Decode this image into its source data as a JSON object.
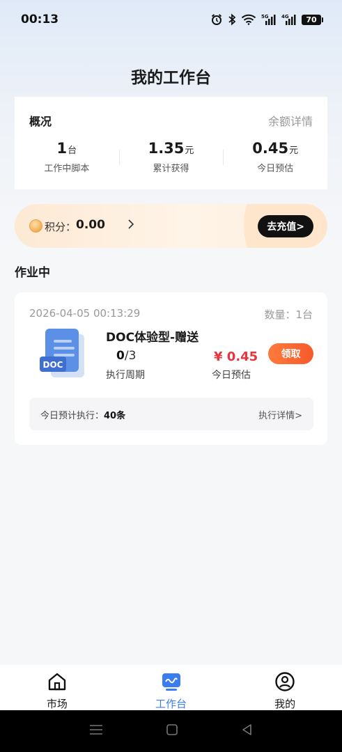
{
  "status": {
    "time": "00:13",
    "battery": "70",
    "net1": "5G",
    "net2": "4G"
  },
  "header": {
    "title": "我的工作台"
  },
  "overview": {
    "title": "概况",
    "link": "余额详情",
    "stats": [
      {
        "value": "1",
        "unit": "台",
        "label": "工作中脚本"
      },
      {
        "value": "1.35",
        "unit": "元",
        "label": "累计获得"
      },
      {
        "value": "0.45",
        "unit": "元",
        "label": "今日预估"
      }
    ]
  },
  "points": {
    "label": "积分：",
    "value": "0.00",
    "recharge": "去充值>"
  },
  "section": {
    "title": "作业中"
  },
  "job": {
    "time": "2026-04-05 00:13:29",
    "qty": "数量：1台",
    "icon_text": "DOC",
    "name": "DOC体验型-赠送",
    "cycle_done": "0",
    "cycle_total": "/3",
    "cycle_label": "执行周期",
    "income": "¥ 0.45",
    "income_label": "今日预估",
    "claim": "领取",
    "plan_label": "今日预计执行：",
    "plan_value": "40条",
    "detail": "执行详情>"
  },
  "tabbar": {
    "items": [
      {
        "label": "市场",
        "icon": "home-icon"
      },
      {
        "label": "工作台",
        "icon": "workbench-icon"
      },
      {
        "label": "我的",
        "icon": "profile-icon"
      }
    ],
    "active": "工作台",
    "active_color": "#3b7cf0"
  },
  "colors": {
    "accent": "#3b7cf0",
    "price": "#e8343a",
    "claim": "#f65a2a"
  }
}
